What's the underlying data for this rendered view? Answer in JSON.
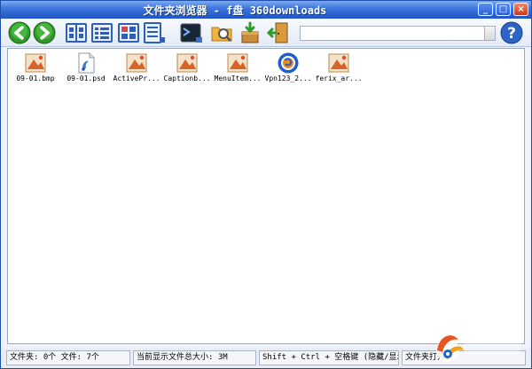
{
  "window": {
    "title": "文件夹浏览器 - f盘 360downloads",
    "minimize_label": "_",
    "maximize_label": "□",
    "close_label": "×"
  },
  "toolbar": {
    "path_value": ""
  },
  "files": [
    {
      "name": "09-01.bmp"
    },
    {
      "name": "09-01.psd"
    },
    {
      "name": "ActivePr..."
    },
    {
      "name": "Captionb..."
    },
    {
      "name": "MenuItem..."
    },
    {
      "name": "Vpn123_2..."
    },
    {
      "name": "ferix_ar..."
    }
  ],
  "status": {
    "counts": "文件夹: 0个  文件: 7个",
    "total_size": "当前显示文件总大小: 3M",
    "shortcut_hint": "Shift + Ctrl + 空格键 (隐藏/显示)",
    "open_hint": "文件夹打开"
  }
}
